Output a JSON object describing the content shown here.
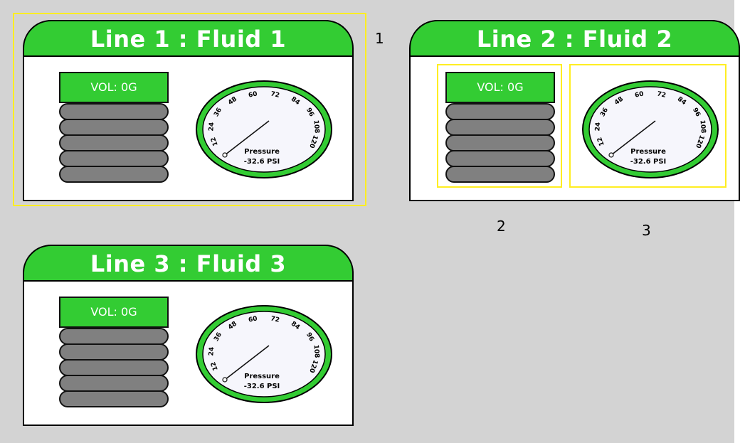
{
  "colors": {
    "header": "#33cc33",
    "coil": "#808080",
    "selection": "#ffee22",
    "background": "#d3d3d3"
  },
  "cards": [
    {
      "title": "Line 1 : Fluid 1",
      "volume": "VOL: 0G",
      "gauge": {
        "label": "Pressure",
        "value": "-32.6 PSI",
        "ticks": [
          "12",
          "24",
          "36",
          "48",
          "60",
          "72",
          "84",
          "96",
          "108",
          "120"
        ]
      }
    },
    {
      "title": "Line 2 : Fluid 2",
      "volume": "VOL: 0G",
      "gauge": {
        "label": "Pressure",
        "value": "-32.6 PSI",
        "ticks": [
          "12",
          "24",
          "36",
          "48",
          "60",
          "72",
          "84",
          "96",
          "108",
          "120"
        ]
      }
    },
    {
      "title": "Line 3 : Fluid 3",
      "volume": "VOL: 0G",
      "gauge": {
        "label": "Pressure",
        "value": "-32.6 PSI",
        "ticks": [
          "12",
          "24",
          "36",
          "48",
          "60",
          "72",
          "84",
          "96",
          "108",
          "120"
        ]
      }
    }
  ],
  "annotations": [
    "1",
    "2",
    "3"
  ]
}
